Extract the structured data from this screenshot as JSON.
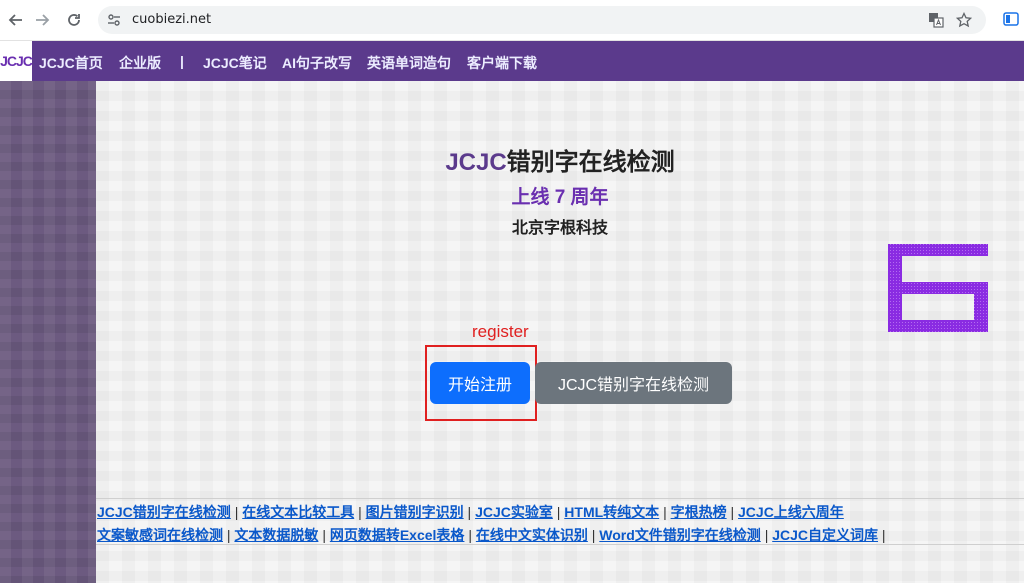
{
  "browser": {
    "url": "cuobiezi.net",
    "icons": [
      "back-icon",
      "forward-icon",
      "reload-icon",
      "site-settings-icon",
      "translate-icon",
      "star-icon",
      "extension-icon"
    ]
  },
  "navbar": {
    "logo": "JCJC",
    "items": [
      {
        "label": "JCJC首页"
      },
      {
        "label": "企业版"
      },
      {
        "label": "|"
      },
      {
        "label": "JCJC笔记"
      },
      {
        "label": "AI句子改写"
      },
      {
        "label": "英语单词造句"
      },
      {
        "label": "客户端下载"
      }
    ]
  },
  "hero": {
    "title_brand": "JCJC",
    "title_rest": "错别字在线检测",
    "subtitle": "上线 7 周年",
    "company": "北京字根科技"
  },
  "annotation": {
    "label": "register",
    "color": "#e02020"
  },
  "buttons": {
    "register_label": "开始注册",
    "check_label": "JCJC错别字在线检测"
  },
  "links": {
    "row1": [
      "JCJC错别字在线检测",
      "在线文本比较工具",
      "图片错别字识别",
      "JCJC实验室",
      "HTML转纯文本",
      "字根热榜",
      "JCJC上线六周年"
    ],
    "row2": [
      "文案敏感词在线检测",
      "文本数据脱敏",
      "网页数据转Excel表格",
      "在线中文实体识别",
      "Word文件错别字在线检测",
      "JCJC自定义词库"
    ],
    "separator": "|"
  },
  "colors": {
    "nav_bg": "#5b3a8c",
    "primary_button": "#0d6efd",
    "secondary_button": "#6c757d",
    "link": "#0a58ca",
    "six_graphic": "#8a2be2"
  }
}
